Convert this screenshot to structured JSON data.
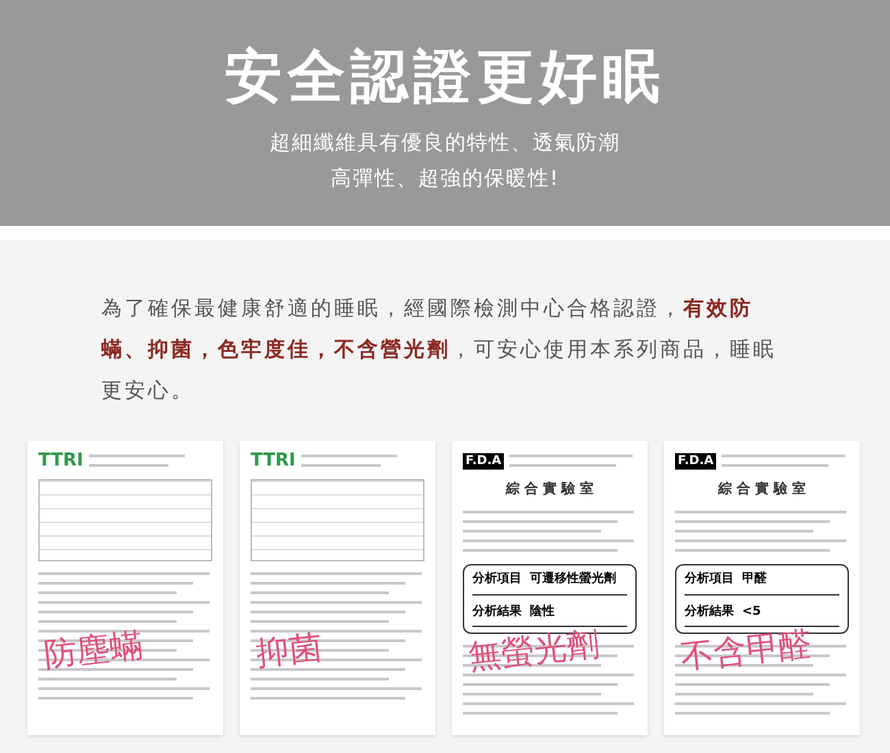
{
  "header": {
    "title": "安全認證更好眠",
    "subtitle_lines": [
      "超細纖維具有優良的特性、透氣防潮",
      "高彈性、超強的保暖性!"
    ]
  },
  "intro": "為了確保最健康舒適的睡眠，經國際檢測中心合格認證，**有效防蟎、抑菌，色牢度佳，不含營光劑**，可安心使用本系列商品，睡眠更安心。",
  "documents": [
    {
      "kind": "ttri",
      "logo": "TTRI",
      "stamp": "防塵蟎"
    },
    {
      "kind": "ttri",
      "logo": "TTRI",
      "stamp": "抑菌"
    },
    {
      "kind": "fda",
      "logo": "F.D.A",
      "heading": "綜 合 實 驗 室",
      "rows": [
        {
          "label": "分析項目",
          "value": "可遷移性螢光劑"
        },
        {
          "label": "分析結果",
          "value": "陰性"
        }
      ],
      "stamp": "無螢光劑"
    },
    {
      "kind": "fda",
      "logo": "F.D.A",
      "heading": "綜 合 實 驗 室",
      "rows": [
        {
          "label": "分析項目",
          "value": "甲醛"
        },
        {
          "label": "分析結果",
          "value": "<5"
        }
      ],
      "stamp": "不含甲醛"
    }
  ]
}
